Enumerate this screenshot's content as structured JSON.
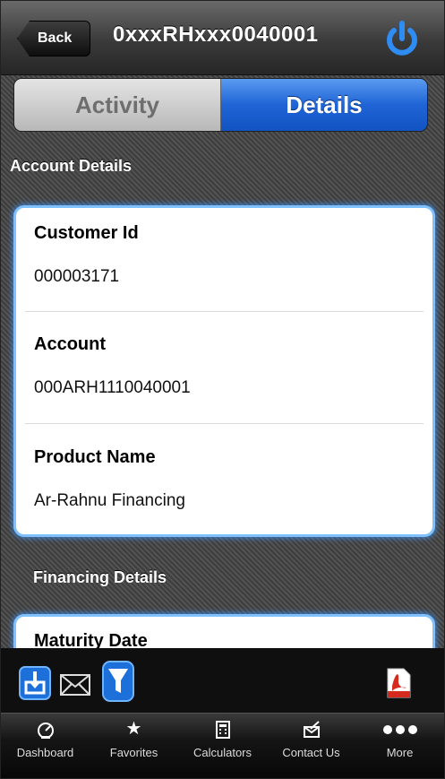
{
  "header": {
    "back_label": "Back",
    "title": "0xxxRHxxx0040001"
  },
  "tabs": {
    "activity": "Activity",
    "details": "Details",
    "selected": "Details"
  },
  "account_details": {
    "section_title": "Account Details",
    "fields": [
      {
        "label": "Customer Id",
        "value": "000003171"
      },
      {
        "label": "Account",
        "value": "000ARH1110040001"
      },
      {
        "label": "Product Name",
        "value": "Ar-Rahnu Financing"
      }
    ]
  },
  "financing_details": {
    "section_title": "Financing Details",
    "fields": [
      {
        "label": "Maturity Date"
      }
    ]
  },
  "toolbar": {
    "icons": [
      "download-icon",
      "mail-icon",
      "filter-icon",
      "pdf-icon"
    ]
  },
  "tabbar": {
    "items": [
      {
        "label": "Dashboard",
        "icon": "gauge-icon"
      },
      {
        "label": "Favorites",
        "icon": "star-icon"
      },
      {
        "label": "Calculators",
        "icon": "calculator-icon"
      },
      {
        "label": "Contact Us",
        "icon": "contact-icon"
      },
      {
        "label": "More",
        "icon": "more-icon"
      }
    ]
  },
  "colors": {
    "accent_blue": "#1f64d6",
    "card_glow": "#7fc0ff",
    "pdf_red": "#d62a1e"
  }
}
